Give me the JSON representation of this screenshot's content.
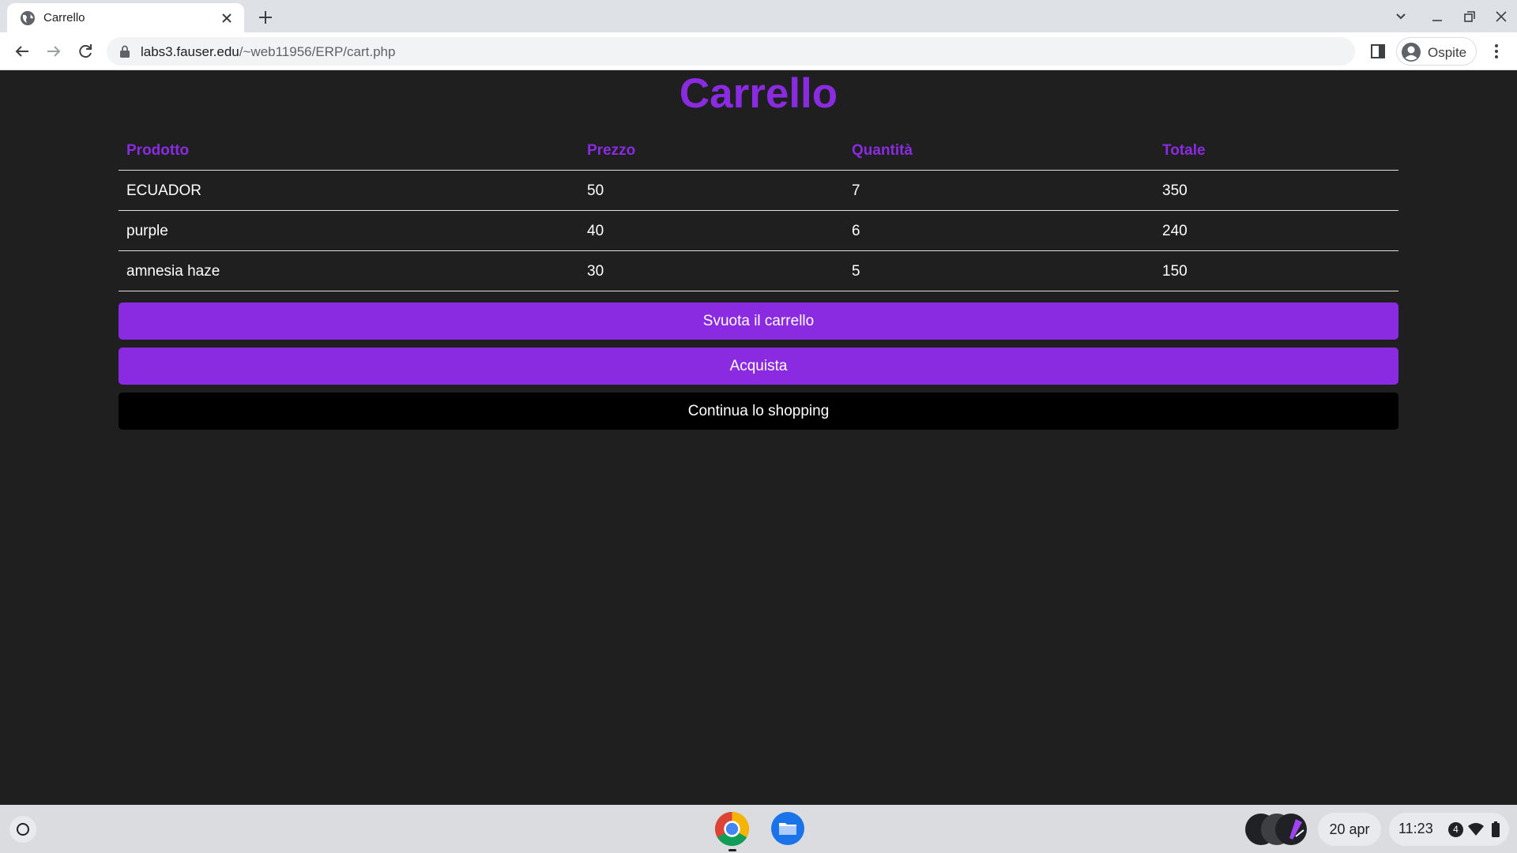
{
  "browser": {
    "tab_title": "Carrello",
    "url_host": "labs3.fauser.edu",
    "url_path": "/~web11956/ERP/cart.php",
    "profile_label": "Ospite"
  },
  "page": {
    "title": "Carrello",
    "table": {
      "headers": [
        "Prodotto",
        "Prezzo",
        "Quantità",
        "Totale"
      ],
      "rows": [
        [
          "ECUADOR",
          "50",
          "7",
          "350"
        ],
        [
          "purple",
          "40",
          "6",
          "240"
        ],
        [
          "amnesia haze",
          "30",
          "5",
          "150"
        ]
      ]
    },
    "buttons": {
      "empty_cart": "Svuota il carrello",
      "buy": "Acquista",
      "continue_shopping": "Continua lo shopping"
    }
  },
  "shelf": {
    "date": "20 apr",
    "time": "11:23",
    "notification_count": "4"
  },
  "colors": {
    "accent": "#8a2be2",
    "page_background": "#1f1f1f",
    "text": "#ffffff"
  },
  "icons": [
    "globe-icon",
    "close-icon",
    "plus-icon",
    "chevron-down-icon",
    "minimize-icon",
    "restore-icon",
    "back-icon",
    "forward-icon",
    "reload-icon",
    "lock-icon",
    "side-panel-icon",
    "avatar-icon",
    "kebab-menu-icon",
    "launcher-icon",
    "chrome-icon",
    "files-icon",
    "wifi-icon",
    "battery-icon"
  ]
}
